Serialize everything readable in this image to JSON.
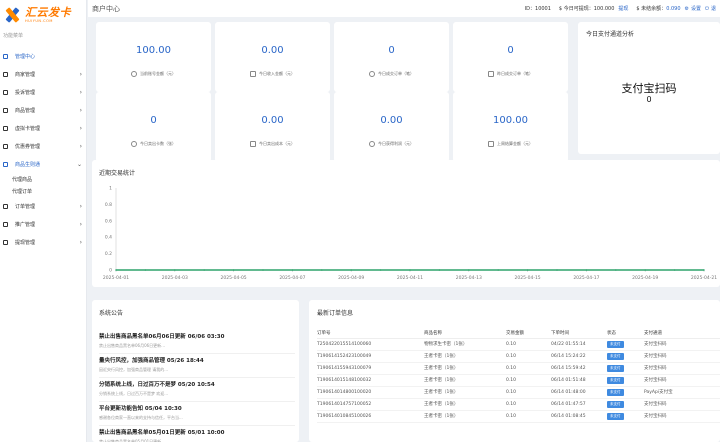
{
  "logo": {
    "title": "汇云发卡",
    "subtitle": "HUIYUN.COM"
  },
  "sidebar": {
    "heading": "功能菜单",
    "items": [
      {
        "label": "管理中心",
        "active": true,
        "chevron": "",
        "icon": "dashboard-icon"
      },
      {
        "label": "商家管理",
        "chevron": "›",
        "icon": "user-icon"
      },
      {
        "label": "投诉管理",
        "chevron": "›",
        "icon": "complaint-icon"
      },
      {
        "label": "商品管理",
        "chevron": "›",
        "icon": "goods-icon"
      },
      {
        "label": "虚拟卡管理",
        "chevron": "›",
        "icon": "card-icon"
      },
      {
        "label": "优惠券管理",
        "chevron": "›",
        "icon": "coupon-icon"
      },
      {
        "label": "商品生则通",
        "chevron": "⌄",
        "open": true,
        "icon": "proxy-icon"
      }
    ],
    "sub_items": [
      "代理商品",
      "代理订单"
    ],
    "items2": [
      {
        "label": "订单管理",
        "chevron": "›",
        "icon": "order-icon"
      },
      {
        "label": "推广管理",
        "chevron": "›",
        "icon": "promo-icon"
      },
      {
        "label": "提现管理",
        "chevron": "›",
        "icon": "withdraw-icon"
      }
    ]
  },
  "topbar": {
    "title": "商户中心",
    "id_label": "ID：10001",
    "withdraw_label": "$ 今日可提现：",
    "withdraw_value": "100.000",
    "withdraw_link": "提现",
    "unsettled_label": "$ 未结余额：",
    "unsettled_value": "0.090",
    "settings": "设置",
    "exit": "退"
  },
  "stats": [
    {
      "value": "100.00",
      "label": "当前账号金额（元）",
      "icon": "wallet-icon"
    },
    {
      "value": "0.00",
      "label": "今日收入金额（元）",
      "icon": "income-icon"
    },
    {
      "value": "0",
      "label": "今日成交订单（笔）",
      "icon": "order-icon"
    },
    {
      "value": "0",
      "label": "昨日成交订单（笔）",
      "icon": "order-icon"
    },
    {
      "value": "0",
      "label": "今日卖出卡数（张）",
      "icon": "card-icon"
    },
    {
      "value": "0.00",
      "label": "今日卖出成本（元）",
      "icon": "cost-icon"
    },
    {
      "value": "0.00",
      "label": "今日获得利润（元）",
      "icon": "profit-icon"
    },
    {
      "value": "100.00",
      "label": "上周结算金额（元）",
      "icon": "settle-icon"
    }
  ],
  "pay": {
    "title": "今日支付通道分析",
    "method": "支付宝扫码",
    "count": "0"
  },
  "chart_title": "近期交易统计",
  "chart_data": {
    "type": "line",
    "title": "",
    "x": [
      "2025-04-01",
      "2025-04-02",
      "2025-04-03",
      "2025-04-04",
      "2025-04-05",
      "2025-04-06",
      "2025-04-07",
      "2025-04-08",
      "2025-04-09",
      "2025-04-10",
      "2025-04-11",
      "2025-04-12",
      "2025-04-13",
      "2025-04-14",
      "2025-04-15",
      "2025-04-16",
      "2025-04-17",
      "2025-04-18",
      "2025-04-19",
      "2025-04-20",
      "2025-04-21"
    ],
    "tick_labels": [
      "2025-04-01",
      "2025-04-03",
      "2025-04-05",
      "2025-04-07",
      "2025-04-09",
      "2025-04-11",
      "2025-04-13",
      "2025-04-15",
      "2025-04-17",
      "2025-04-19",
      "2025-04-21"
    ],
    "y_ticks": [
      "0",
      "0.2",
      "0.4",
      "0.6",
      "0.8",
      "1"
    ],
    "ylim": [
      0,
      1
    ],
    "grid": false,
    "series": [
      {
        "values": [
          0,
          0,
          0,
          0,
          0,
          0,
          0,
          0,
          0,
          0,
          0,
          0,
          0,
          0,
          0,
          0,
          0,
          0,
          0,
          0,
          0
        ],
        "color": "#2ea36b"
      }
    ]
  },
  "notice": {
    "title": "系统公告",
    "items": [
      {
        "title": "禁止出售商品黑名单06月06日更新 06/06 03:30",
        "sub": "禁止出售商品黑名单06月06日更新..."
      },
      {
        "title": "量央行风控，加强商品管理 05/26 18:44",
        "sub": "因近央行风控，加强商品管理 请我的..."
      },
      {
        "title": "分销系统上线，日过百万不是梦 05/20 10:54",
        "sub": "分销系统上线，日过百万不是梦 欢迎..."
      },
      {
        "title": "平台更新功能告知 05/04 10:30",
        "sub": "感谢各位商家一直以来的支持与信任，平台当..."
      },
      {
        "title": "禁止出售商品黑名单05月01日更新 05/01 10:00",
        "sub": "禁止出售商品黑名单05月01日更新..."
      }
    ]
  },
  "orders": {
    "title": "最新订单信息",
    "columns": [
      "订单号",
      "商品名称",
      "交易金额",
      "下单时间",
      "状态",
      "支付通道"
    ],
    "rows": [
      [
        "T250422015514100060",
        "物物求生卡密（1张）",
        "0.10",
        "04/22 01:55:14",
        "未支付",
        "支付宝扫码"
      ],
      [
        "T190614152423100049",
        "王者卡密（1张）",
        "0.10",
        "06/14 15:24:22",
        "未支付",
        "支付宝扫码"
      ],
      [
        "T190614155943100079",
        "王者卡密（1张）",
        "0.10",
        "06/14 15:59:42",
        "未支付",
        "支付宝扫码"
      ],
      [
        "T190614015148100032",
        "王者卡密（1张）",
        "0.10",
        "06/14 01:51:48",
        "未支付",
        "支付宝扫码"
      ],
      [
        "T190614014800100020",
        "王者卡密（1张）",
        "0.10",
        "06/14 01:48:00",
        "未支付",
        "PayApi支付宝"
      ],
      [
        "T190614014757100052",
        "王者卡密（1张）",
        "0.10",
        "06/14 01:47:57",
        "未支付",
        "支付宝扫码"
      ],
      [
        "T190614010845100026",
        "王者卡密（1张）",
        "0.10",
        "06/14 01:08:45",
        "未支付",
        "支付宝扫码"
      ]
    ]
  }
}
